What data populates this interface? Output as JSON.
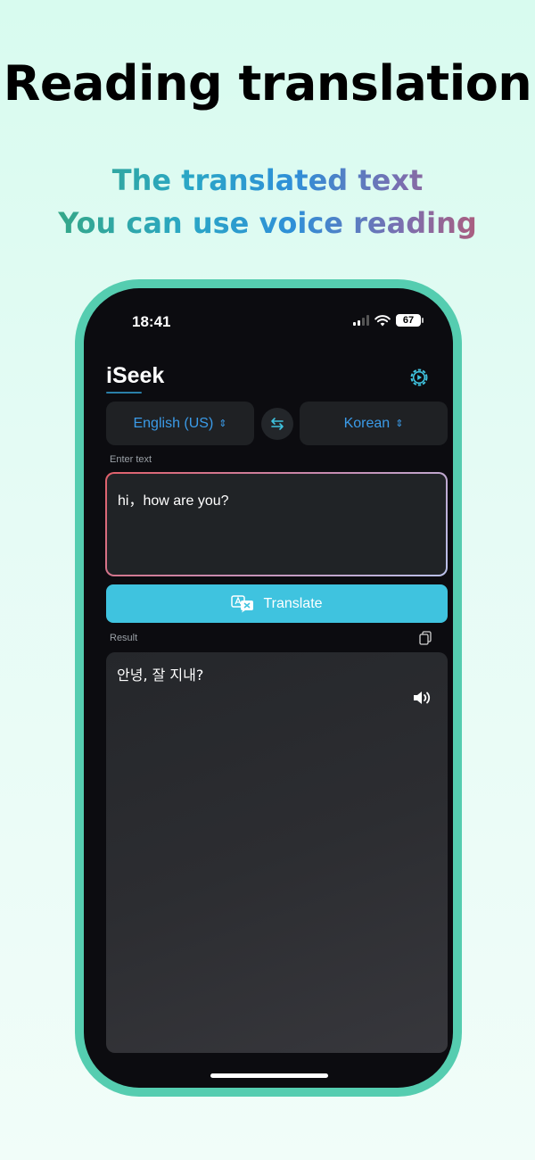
{
  "headline": "Reading translation",
  "subtitle_line1": "The translated text",
  "subtitle_line2": "You can use voice reading",
  "status_bar": {
    "time": "18:41",
    "battery": "67"
  },
  "app": {
    "title": "iSeek",
    "source_language": "English (US)",
    "target_language": "Korean",
    "input_label": "Enter text",
    "input_value": "hi，how are you?",
    "translate_button": "Translate",
    "result_label": "Result",
    "result_text": "안녕, 잘 지내?"
  },
  "colors": {
    "phone_frame": "#55cdb0",
    "accent_blue": "#3b9be8",
    "translate_button": "#3fc3df",
    "screen_bg": "#0c0c10"
  },
  "icons": [
    "gear-icon",
    "swap-icon",
    "translate-icon",
    "copy-icon",
    "speaker-icon",
    "wifi-icon",
    "signal-icon",
    "battery-icon"
  ]
}
